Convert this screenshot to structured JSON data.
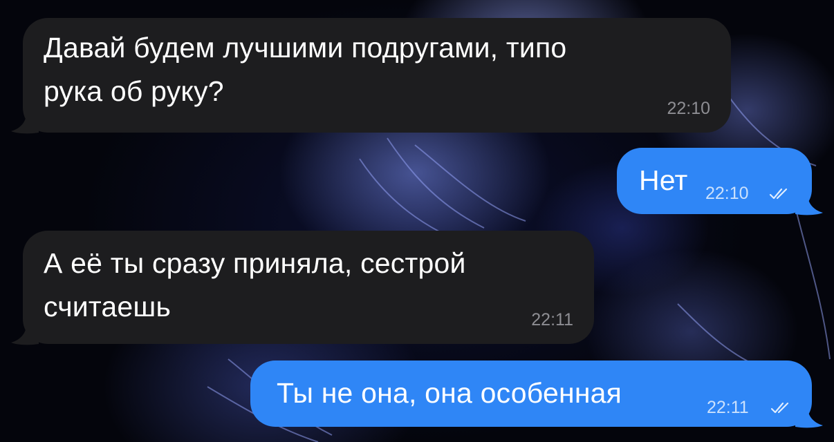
{
  "chat": {
    "messages": [
      {
        "direction": "incoming",
        "text": "Давай будем лучшими подругами, типо\nрука об руку?",
        "time": "22:10"
      },
      {
        "direction": "outgoing",
        "text": "Нет",
        "time": "22:10",
        "status": "read-checkmarks-icon"
      },
      {
        "direction": "incoming",
        "text": "А её ты сразу приняла, сестрой\nсчитаешь",
        "time": "22:11"
      },
      {
        "direction": "outgoing",
        "text": "Ты не она, она особенная",
        "time": "22:11",
        "status": "read-checkmarks-icon"
      }
    ]
  },
  "colors": {
    "incoming_bubble": "#1d1d1f",
    "outgoing_bubble": "#2f86f6",
    "timestamp_incoming": "#8e8e93",
    "wallpaper_glow": "#7f8cf0"
  }
}
